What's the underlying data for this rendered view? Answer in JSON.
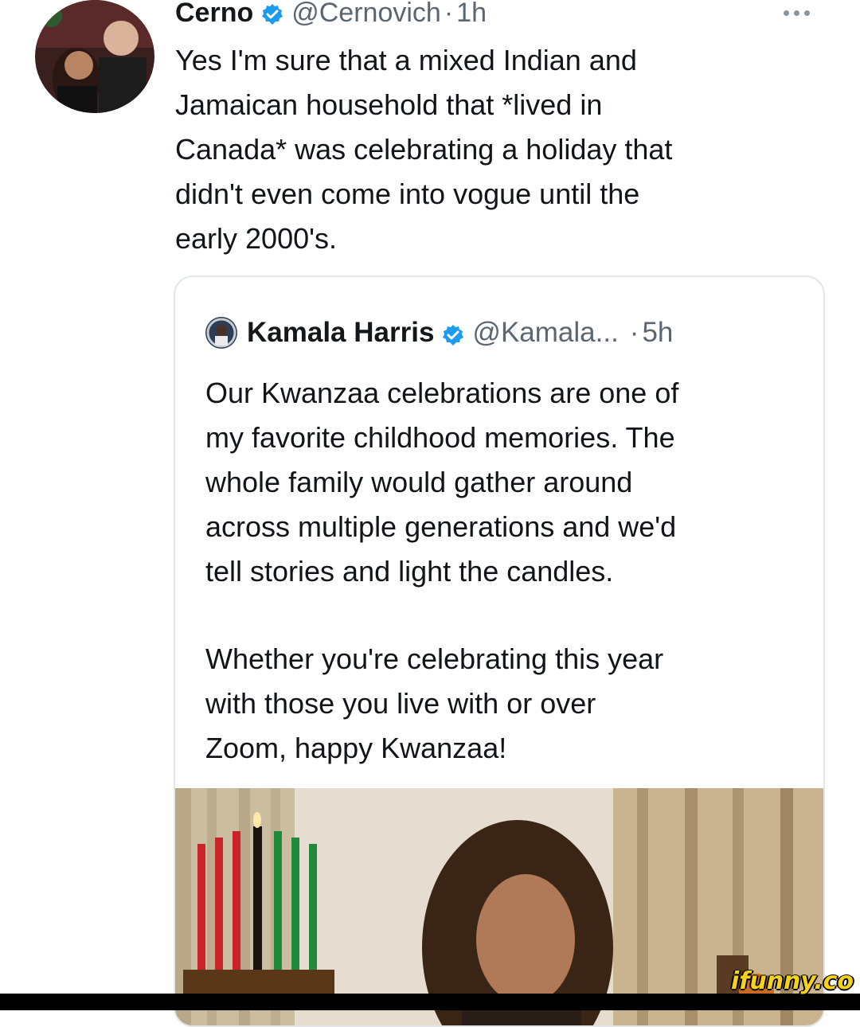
{
  "tweet": {
    "author_name": "Cerno",
    "author_handle": "@Cernovich",
    "separator": "·",
    "time": "1h",
    "text": "Yes I'm sure that a mixed Indian and\nJamaican household that *lived in\nCanada* was celebrating a holiday that\ndidn't even come into vogue until the\nearly 2000's.",
    "icons": {
      "verified": "verified-badge-icon",
      "more": "more-options-icon"
    }
  },
  "quoted_tweet": {
    "author_name": "Kamala Harris",
    "author_handle": "@Kamala...",
    "separator": "·",
    "time": "5h",
    "paragraph_1": "Our Kwanzaa celebrations are one of\nmy favorite childhood memories. The\nwhole family would gather around\nacross multiple generations and we'd\ntell stories and light the candles.",
    "paragraph_2": "Whether you're celebrating this year\nwith those you live with or over\nZoom, happy Kwanzaa!"
  },
  "watermark": "ifunny.co",
  "colors": {
    "verified_blue": "#1d9bf0",
    "text": "#111418",
    "secondary": "#5b6670",
    "border": "#e3e6e9",
    "watermark": "#f6d21a"
  }
}
